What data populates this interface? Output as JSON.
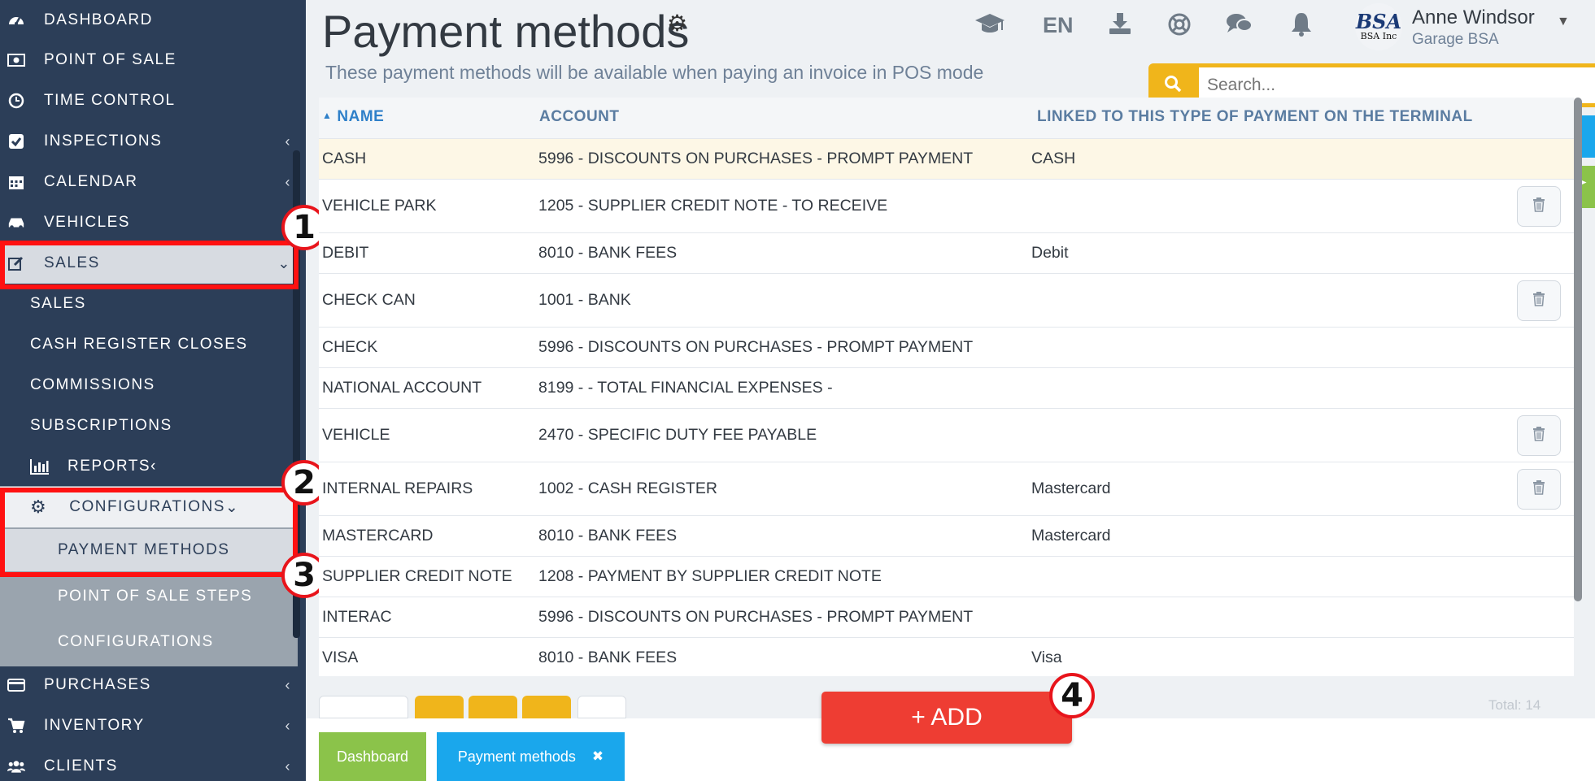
{
  "sidebar": {
    "items": [
      {
        "label": "DASHBOARD",
        "icon": "dashboard-icon"
      },
      {
        "label": "POINT OF SALE",
        "icon": "money-icon"
      },
      {
        "label": "TIME CONTROL",
        "icon": "clock-icon"
      },
      {
        "label": "INSPECTIONS",
        "icon": "checkbox-icon"
      },
      {
        "label": "CALENDAR",
        "icon": "calendar-icon"
      },
      {
        "label": "VEHICLES",
        "icon": "car-icon"
      },
      {
        "label": "SALES",
        "icon": "edit-icon"
      }
    ],
    "sales_sub": [
      "SALES",
      "CASH REGISTER CLOSES",
      "COMMISSIONS",
      "SUBSCRIPTIONS"
    ],
    "reports_label": "REPORTS",
    "configurations_label": "CONFIGURATIONS",
    "config_sub": [
      "PAYMENT METHODS",
      "POINT OF SALE STEPS",
      "CONFIGURATIONS"
    ],
    "bottom_items": [
      {
        "label": "PURCHASES",
        "icon": "credit-card-icon"
      },
      {
        "label": "INVENTORY",
        "icon": "cart-icon"
      },
      {
        "label": "CLIENTS",
        "icon": "users-icon"
      }
    ]
  },
  "callouts": [
    "1",
    "2",
    "3",
    "4"
  ],
  "header": {
    "title": "Payment methods",
    "subtitle": "These payment methods will be available when paying an invoice in POS mode",
    "language": "EN",
    "user_name": "Anne Windsor",
    "user_org": "Garage BSA",
    "avatar_logo": "BSA",
    "avatar_logo_sub": "BSA Inc",
    "search_placeholder": "Search..."
  },
  "table": {
    "headers": {
      "name": "NAME",
      "account": "ACCOUNT",
      "linked": "LINKED TO THIS TYPE OF PAYMENT ON THE TERMINAL"
    },
    "rows": [
      {
        "name": "CASH",
        "account": "5996 - DISCOUNTS ON PURCHASES - PROMPT PAYMENT",
        "linked": "CASH",
        "delete": false
      },
      {
        "name": "VEHICLE PARK",
        "account": "1205 - SUPPLIER CREDIT NOTE - TO RECEIVE",
        "linked": "",
        "delete": true
      },
      {
        "name": "DEBIT",
        "account": "8010 - BANK FEES",
        "linked": "Debit",
        "delete": false
      },
      {
        "name": "CHECK CAN",
        "account": "1001 - BANK",
        "linked": "",
        "delete": true
      },
      {
        "name": "CHECK",
        "account": "5996 - DISCOUNTS ON PURCHASES - PROMPT PAYMENT",
        "linked": "",
        "delete": false
      },
      {
        "name": "NATIONAL ACCOUNT",
        "account": "8199 - - TOTAL FINANCIAL EXPENSES -",
        "linked": "",
        "delete": false
      },
      {
        "name": "VEHICLE",
        "account": "2470 - SPECIFIC DUTY FEE PAYABLE",
        "linked": "",
        "delete": true
      },
      {
        "name": "INTERNAL REPAIRS",
        "account": "1002 - CASH REGISTER",
        "linked": "Mastercard",
        "delete": true
      },
      {
        "name": "MASTERCARD",
        "account": "8010 - BANK FEES",
        "linked": "Mastercard",
        "delete": false
      },
      {
        "name": "SUPPLIER CREDIT NOTE",
        "account": "1208 - PAYMENT BY SUPPLIER CREDIT NOTE",
        "linked": "",
        "delete": false
      },
      {
        "name": "INTERAC",
        "account": "5996 - DISCOUNTS ON PURCHASES - PROMPT PAYMENT",
        "linked": "",
        "delete": false
      },
      {
        "name": "VISA",
        "account": "8010 - BANK FEES",
        "linked": "Visa",
        "delete": false
      }
    ]
  },
  "add_button": "+ ADD",
  "footer_total": "Total: 14",
  "tabs": [
    {
      "label": "Dashboard"
    },
    {
      "label": "Payment methods",
      "close": "✖"
    }
  ],
  "colors": {
    "sidebar": "#2c3e58",
    "accent_yellow": "#f0b51b",
    "add_red": "#ee3d33",
    "tab_green": "#8bc34a",
    "tab_blue": "#1aa7ec",
    "annotation_red": "#ff1111"
  }
}
